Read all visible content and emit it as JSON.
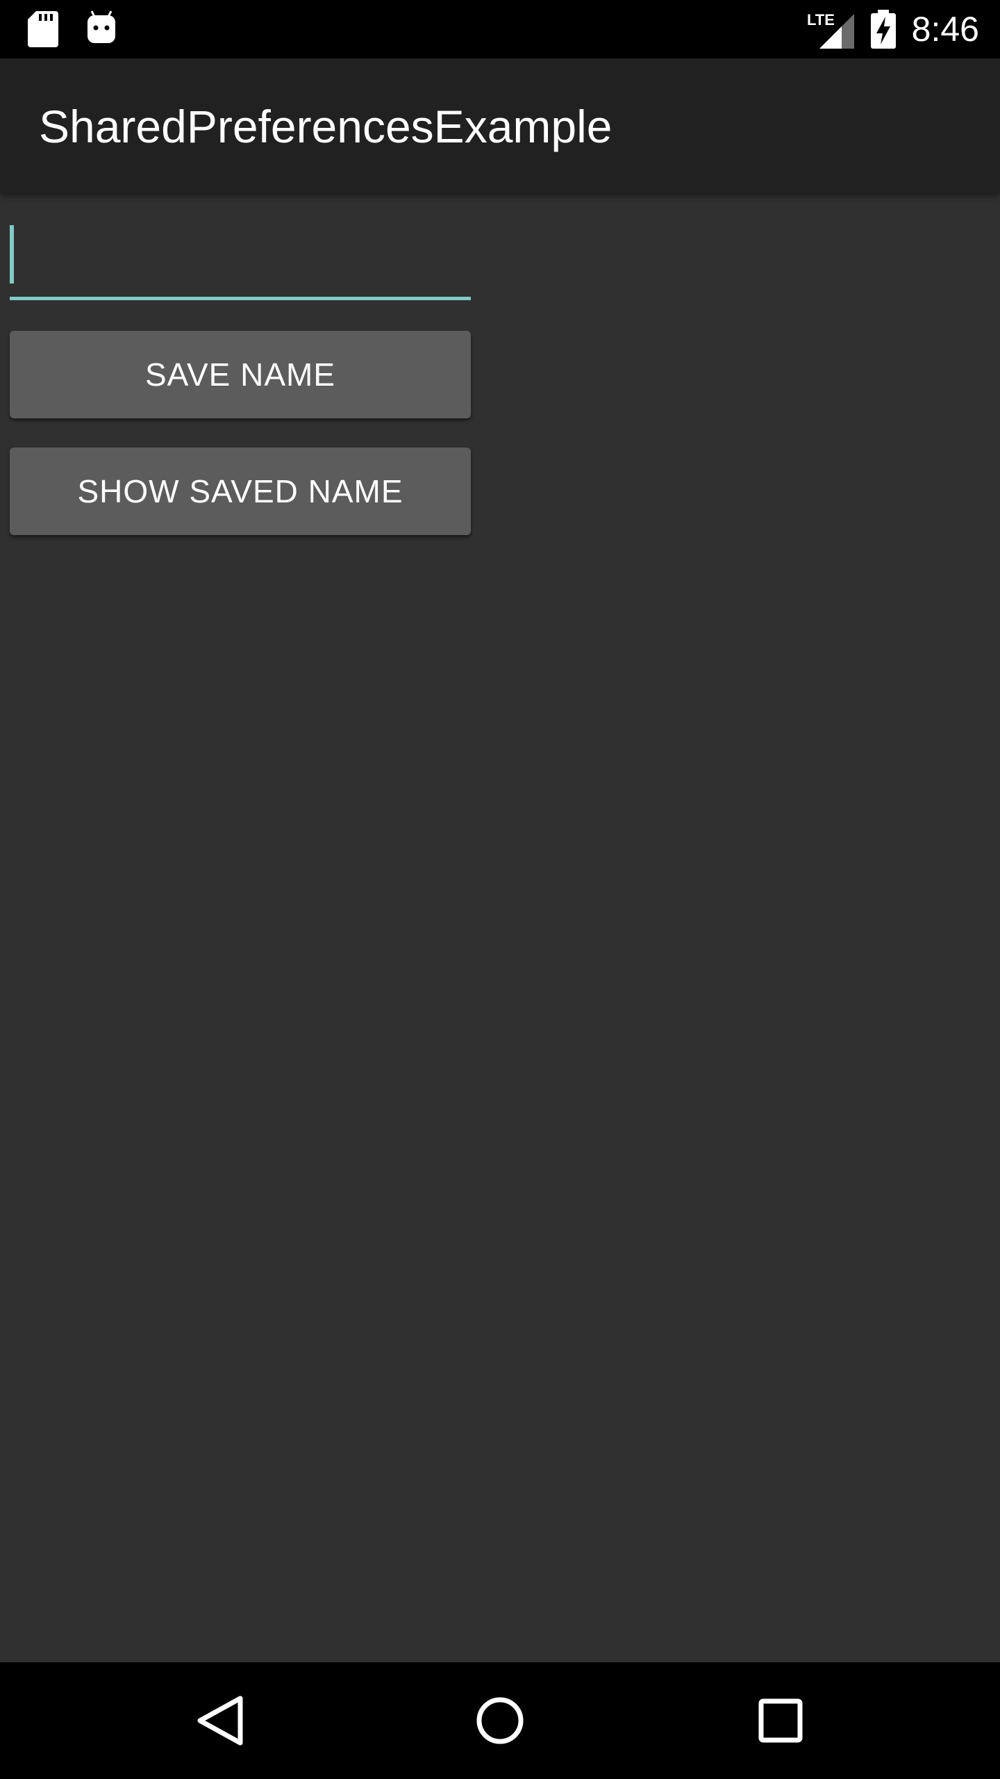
{
  "status_bar": {
    "time": "8:46",
    "icons": [
      "sd-card-icon",
      "android-icon",
      "lte-signal-icon",
      "battery-charging-icon"
    ],
    "network_label": "LTE"
  },
  "app_bar": {
    "title": "SharedPreferencesExample"
  },
  "form": {
    "name_input_value": "",
    "name_input_placeholder": "",
    "save_button_label": "SAVE NAME",
    "show_button_label": "SHOW SAVED NAME"
  },
  "nav_bar": {
    "icons": [
      "back-icon",
      "home-icon",
      "recents-icon"
    ]
  },
  "colors": {
    "accent": "#80cbc4",
    "background": "#303030",
    "app_bar": "#212121",
    "button": "#5c5c5d",
    "system_bars": "#000000"
  }
}
